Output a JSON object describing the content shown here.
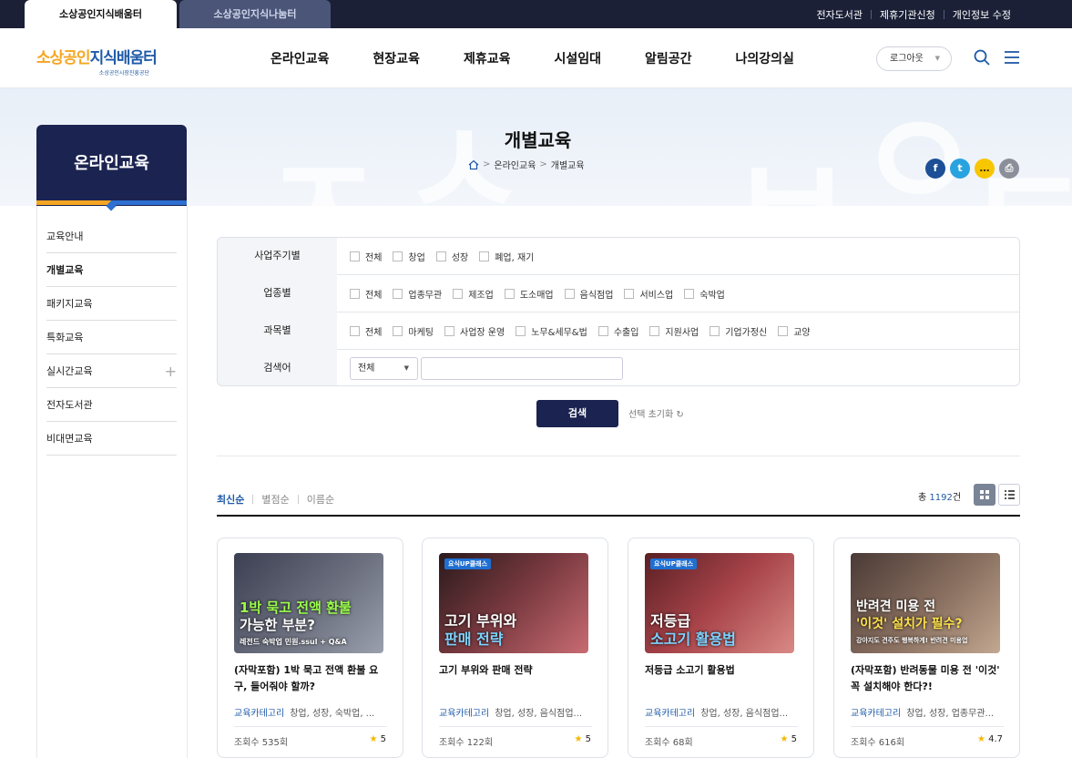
{
  "top_tabs": [
    "소상공인지식배움터",
    "소상공인지식나눔터"
  ],
  "top_links": [
    "전자도서관",
    "제휴기관신청",
    "개인정보 수정"
  ],
  "logo": {
    "main_orange": "소상공인",
    "main_blue": "지식배움터",
    "sub": "소상공인시장진흥공단"
  },
  "gnb": [
    "온라인교육",
    "현장교육",
    "제휴교육",
    "시설임대",
    "알림공간",
    "나의강의실"
  ],
  "header": {
    "logout": "로그아웃"
  },
  "page": {
    "title": "개별교육",
    "breadcrumb": [
      "온라인교육",
      "개별교육"
    ]
  },
  "share": [
    "f",
    "t",
    "…",
    "⎙"
  ],
  "lnb": {
    "title": "온라인교육",
    "items": [
      "교육안내",
      "개별교육",
      "패키지교육",
      "특화교육",
      "실시간교육",
      "전자도서관",
      "비대면교육"
    ]
  },
  "filter": {
    "rows": [
      {
        "label": "사업주기별",
        "options": [
          "전체",
          "창업",
          "성장",
          "폐업, 재기"
        ]
      },
      {
        "label": "업종별",
        "options": [
          "전체",
          "업종무관",
          "제조업",
          "도소매업",
          "음식점업",
          "서비스업",
          "숙박업"
        ]
      },
      {
        "label": "과목별",
        "options": [
          "전체",
          "마케팅",
          "사업장 운영",
          "노무&세무&법",
          "수출입",
          "지원사업",
          "기업가정신",
          "교양"
        ]
      }
    ],
    "search_label": "검색어",
    "search_select": "전체",
    "search_button": "검색",
    "reset": "선택 초기화"
  },
  "sorts": [
    "최신순",
    "별점순",
    "이름순"
  ],
  "total": {
    "prefix": "총 ",
    "count": "1192",
    "suffix": "건"
  },
  "cards": [
    {
      "thumb_line1": "1박 묵고 전액 환불",
      "thumb_line2": "가능한 부분?",
      "thumb_sub": "레전드 숙박업 민원.ssul + Q&A",
      "title": "(자막포함) 1박 묵고 전액 환불 요구, 들어줘야 할까?",
      "cat_key": "교육카테고리",
      "cat_val": "창업, 성장, 숙박업, ...",
      "views": "조회수 535회",
      "rating": "5"
    },
    {
      "thumb_tag": "요식UP클래스",
      "thumb_line1": "고기 부위와",
      "thumb_line2": "판매 전략",
      "title": "고기 부위와 판매 전략",
      "cat_key": "교육카테고리",
      "cat_val": "창업, 성장, 음식점업...",
      "views": "조회수 122회",
      "rating": "5"
    },
    {
      "thumb_tag": "요식UP클래스",
      "thumb_line1": "저등급",
      "thumb_line2": "소고기 활용법",
      "title": "저등급 소고기 활용법",
      "cat_key": "교육카테고리",
      "cat_val": "창업, 성장, 음식점업...",
      "views": "조회수 68회",
      "rating": "5"
    },
    {
      "thumb_line1": "반려견 미용 전",
      "thumb_line2": "'이것' 설치가 필수?",
      "thumb_sub": "강아지도 견주도 행복하게! 반려견 미용업",
      "title": "(자막포함) 반려동물 미용 전 '이것' 꼭 설치해야 한다?!",
      "cat_key": "교육카테고리",
      "cat_val": "창업, 성장, 업종무관...",
      "views": "조회수 616회",
      "rating": "4.7"
    }
  ]
}
